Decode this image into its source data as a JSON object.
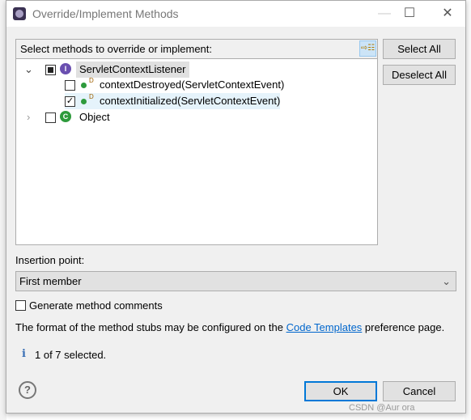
{
  "window": {
    "title": "Override/Implement Methods",
    "minimize": "—",
    "maximize": "☐",
    "close": "✕"
  },
  "methods": {
    "label": "Select methods to override or implement:",
    "tree": [
      {
        "label": "ServletContextListener",
        "kind": "interface",
        "expanded": true,
        "check": "partial",
        "children": [
          {
            "label": "contextDestroyed(ServletContextEvent)",
            "checked": false,
            "badge": "D"
          },
          {
            "label": "contextInitialized(ServletContextEvent)",
            "checked": true,
            "badge": "D"
          }
        ]
      },
      {
        "label": "Object",
        "kind": "class",
        "expanded": false,
        "check": "unchecked"
      }
    ]
  },
  "buttons": {
    "select_all": "Select All",
    "deselect_all": "Deselect All",
    "ok": "OK",
    "cancel": "Cancel"
  },
  "insertion": {
    "label": "Insertion point:",
    "value": "First member"
  },
  "generate_comments": {
    "label": "Generate method comments",
    "checked": false
  },
  "info": {
    "prefix": "The format of the method stubs may be configured on the ",
    "link": "Code Templates",
    "suffix": " preference page."
  },
  "status": "1 of 7 selected.",
  "watermark": "CSDN @Aur ora",
  "colors": {
    "accent": "#0078d7",
    "link": "#0066cc",
    "interface_icon": "#6a4fb0",
    "class_icon": "#2e9a3c"
  }
}
